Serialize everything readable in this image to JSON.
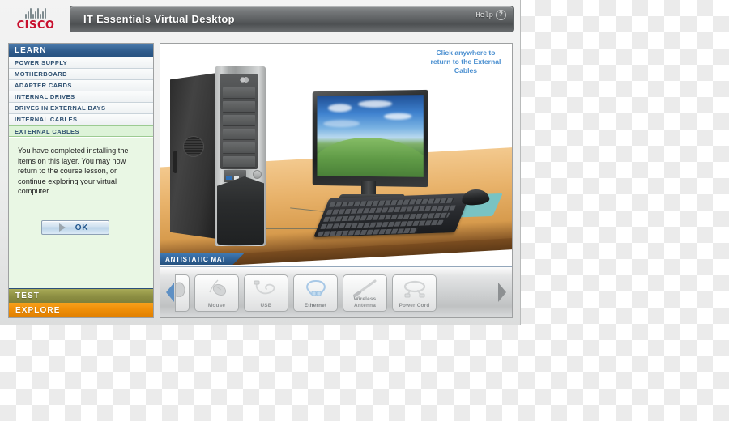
{
  "app": {
    "brand": "CISCO",
    "brand_mark": "cisco-logo",
    "title": "IT Essentials Virtual Desktop",
    "help_label": "Help",
    "help_icon": "question-circle-icon"
  },
  "sidebar": {
    "learn_header": "LEARN",
    "menu": [
      {
        "label": "POWER SUPPLY",
        "active": false
      },
      {
        "label": "MOTHERBOARD",
        "active": false
      },
      {
        "label": "ADAPTER CARDS",
        "active": false
      },
      {
        "label": "INTERNAL DRIVES",
        "active": false
      },
      {
        "label": "DRIVES IN EXTERNAL BAYS",
        "active": false
      },
      {
        "label": "INTERNAL CABLES",
        "active": false
      },
      {
        "label": "EXTERNAL CABLES",
        "active": true
      }
    ],
    "info_text": "You have completed installing the items on this layer. You may now return to the course lesson, or continue exploring your virtual computer.",
    "ok_label": "OK",
    "test_header": "TEST",
    "explore_header": "EXPLORE"
  },
  "stage": {
    "hint": "Click anywhere to return to the External Cables",
    "mat_label": "ANTISTATIC MAT",
    "scene_items": [
      "computer-tower",
      "lcd-monitor",
      "keyboard",
      "mouse",
      "mousepad",
      "wooden-desk"
    ]
  },
  "tray": {
    "prev_arrow": "arrow-left-icon",
    "next_arrow": "arrow-right-icon",
    "items": [
      {
        "label": "",
        "icon": "partial-item-icon",
        "state": "partial"
      },
      {
        "label": "Mouse",
        "icon": "mouse-icon",
        "state": "inactive"
      },
      {
        "label": "USB",
        "icon": "usb-cable-icon",
        "state": "inactive"
      },
      {
        "label": "Ethernet",
        "icon": "ethernet-cable-icon",
        "state": "active"
      },
      {
        "label": "Wireless Antenna",
        "icon": "wireless-antenna-icon",
        "state": "inactive"
      },
      {
        "label": "Power Cord",
        "icon": "power-cord-icon",
        "state": "inactive"
      }
    ]
  },
  "colors": {
    "learn_header": "#2f5c8c",
    "active_item_bg": "#ddf3d8",
    "info_panel_bg": "#e9f7e4",
    "test_header": "#8f9144",
    "explore_header": "#ef8f08",
    "hint_text": "#4a8fd0",
    "brand_red": "#c8102e",
    "mat_tab": "#2d5f93"
  }
}
